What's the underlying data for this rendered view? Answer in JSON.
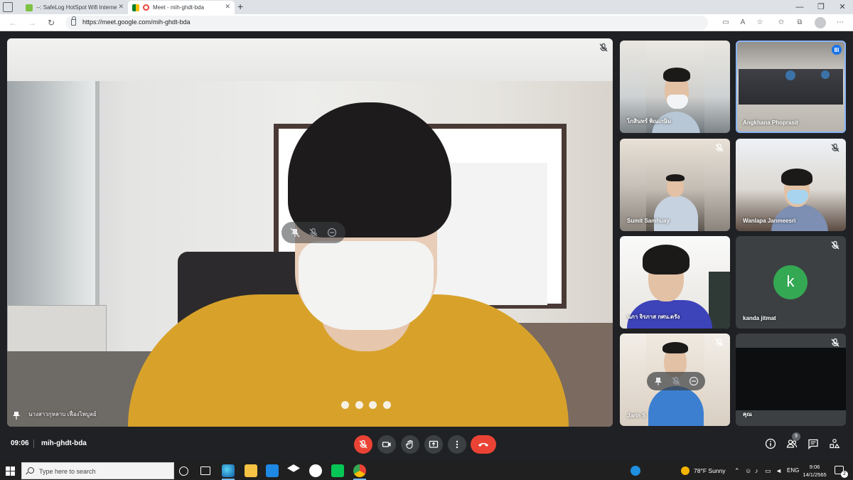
{
  "browser": {
    "tabs": [
      {
        "title": "--: SafeLog HotSpot Wifi Interne",
        "active": false,
        "favicon_color": "#7dc242"
      },
      {
        "title": "Meet - mih-ghdt-bda",
        "active": true,
        "favicon_color": "#00832d"
      }
    ],
    "url": "https://meet.google.com/mih-ghdt-bda",
    "new_tab_label": "+",
    "window_controls": {
      "minimize": "—",
      "maximize": "❐",
      "close": "✕"
    }
  },
  "meet": {
    "main_speaker": {
      "name": "นางสาวกุหลาบ เฟื่องไพบูลย์",
      "muted": true
    },
    "participants": [
      {
        "name": "โกสินทร์ พิณเกษิม",
        "muted": false,
        "speaking": false,
        "background": "office"
      },
      {
        "name": "Angkhana Phoprasit",
        "muted": false,
        "speaking": true,
        "background": "room"
      },
      {
        "name": "Sumit Samhuay",
        "muted": true,
        "speaking": false,
        "background": "car"
      },
      {
        "name": "Wanlapa Janmeesri",
        "muted": true,
        "speaking": false,
        "background": "bedroom"
      },
      {
        "name": "นภา จิรภาส กศน.ตรัง",
        "muted": false,
        "speaking": false,
        "background": "white"
      },
      {
        "name": "kanda jitmat",
        "muted": true,
        "speaking": false,
        "avatar_letter": "k",
        "avatar_color": "#34a853"
      },
      {
        "name": "Jarin S",
        "muted": true,
        "speaking": false,
        "background": "home"
      },
      {
        "name": "คุณ",
        "muted": true,
        "speaking": false,
        "background": "dark"
      }
    ],
    "bottom_bar": {
      "time": "09:06",
      "meeting_code": "mih-ghdt-bda",
      "people_count": "9"
    }
  },
  "taskbar": {
    "search_placeholder": "Type here to search",
    "weather": "78°F  Sunny",
    "language": "ENG",
    "clock_time": "9:06",
    "clock_date": "14/1/2565",
    "notification_count": "2"
  }
}
